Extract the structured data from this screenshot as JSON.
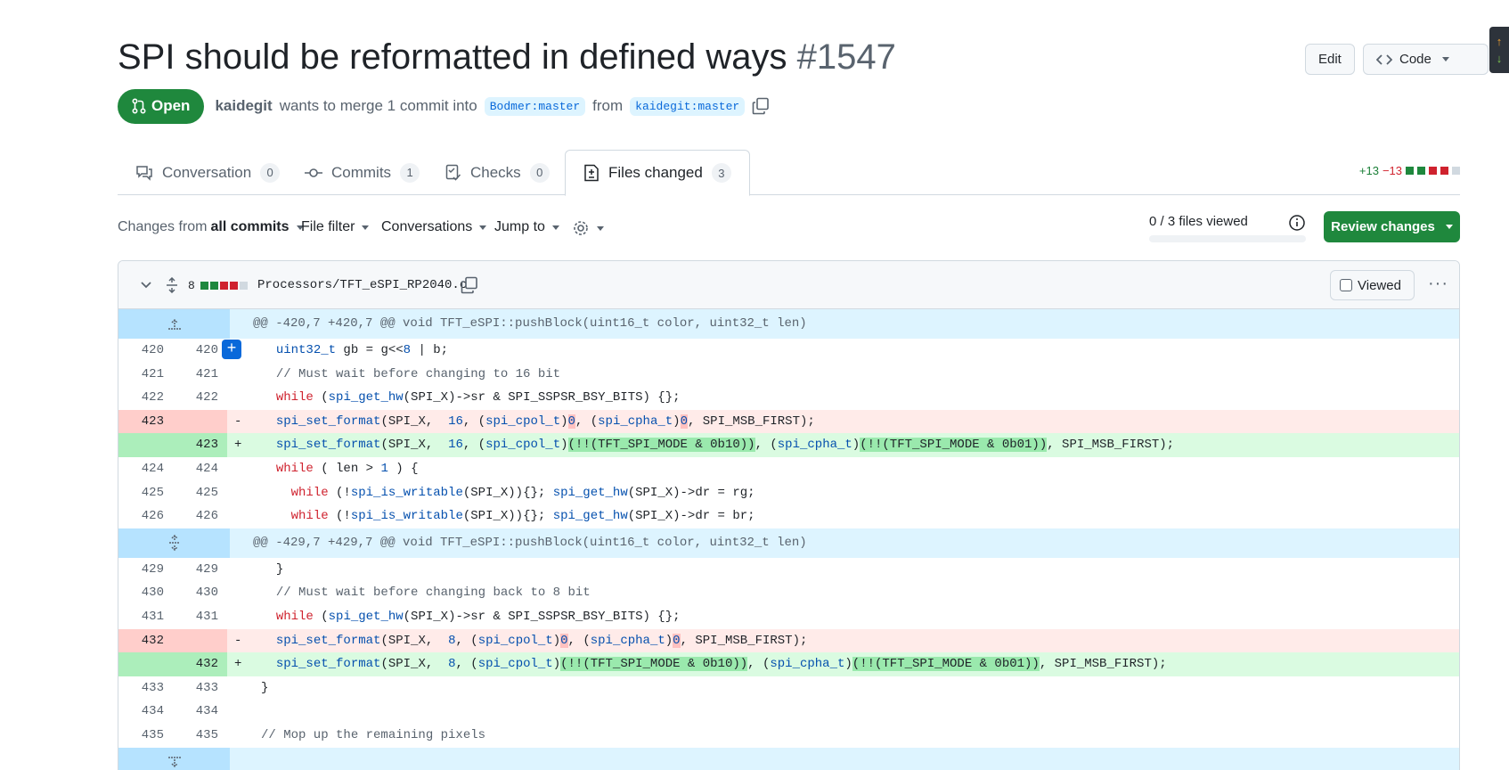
{
  "header": {
    "title": "SPI should be reformatted in defined ways",
    "number": "#1547",
    "edit_label": "Edit",
    "code_label": "Code"
  },
  "subtitle": {
    "state": "Open",
    "author": "kaidegit",
    "action": "wants to merge 1 commit into",
    "base_branch": "Bodmer:master",
    "from": "from",
    "head_branch": "kaidegit:master"
  },
  "tabs": [
    {
      "label": "Conversation",
      "count": "0"
    },
    {
      "label": "Commits",
      "count": "1"
    },
    {
      "label": "Checks",
      "count": "0"
    },
    {
      "label": "Files changed",
      "count": "3"
    }
  ],
  "diffstat": {
    "additions": "+13",
    "deletions": "−13"
  },
  "toolbar": {
    "changes_prefix": "Changes from",
    "changes_value": "all commits",
    "file_filter": "File filter",
    "conversations": "Conversations",
    "jump_to": "Jump to",
    "files_viewed": "0 / 3 files viewed",
    "review_label": "Review changes"
  },
  "file": {
    "changes": "8",
    "path": "Processors/TFT_eSPI_RP2040.c",
    "viewed_label": "Viewed",
    "more": "···"
  },
  "hunks": [
    "@@ -420,7 +420,7 @@ void TFT_eSPI::pushBlock(uint16_t color, uint32_t len)",
    "@@ -429,7 +429,7 @@ void TFT_eSPI::pushBlock(uint16_t color, uint32_t len)"
  ],
  "lines": {
    "l420": {
      "old": "420",
      "new": "420"
    },
    "l421": {
      "old": "421",
      "new": "421"
    },
    "l422": {
      "old": "422",
      "new": "422"
    },
    "l423d": {
      "old": "423",
      "new": ""
    },
    "l423a": {
      "old": "",
      "new": "423"
    },
    "l424": {
      "old": "424",
      "new": "424"
    },
    "l425": {
      "old": "425",
      "new": "425"
    },
    "l426": {
      "old": "426",
      "new": "426"
    },
    "l429": {
      "old": "429",
      "new": "429"
    },
    "l430": {
      "old": "430",
      "new": "430"
    },
    "l431": {
      "old": "431",
      "new": "431"
    },
    "l432d": {
      "old": "432",
      "new": ""
    },
    "l432a": {
      "old": "",
      "new": "432"
    },
    "l433": {
      "old": "433",
      "new": "433"
    },
    "l434": {
      "old": "434",
      "new": "434"
    },
    "l435": {
      "old": "435",
      "new": "435"
    }
  },
  "code": {
    "c420a": "uint32_t",
    "c420b": " gb = g<<",
    "c420c": "8",
    "c420d": " | b;",
    "c421": "// Must wait before changing to 16 bit",
    "c422kw": "while",
    "c422fn": "spi_get_hw",
    "c422rest": "(SPI_X)->sr & SPI_SSPSR_BSY_BITS) {};",
    "setfmt": "spi_set_format",
    "cpol": "spi_cpol_t",
    "cpha": "spi_cpha_t",
    "arg16": "(SPI_X,  ",
    "n16": "16",
    "arg8": "(SPI_X,  ",
    "n8": "8",
    "zero": "0",
    "mode_b10": "(!!(TFT_SPI_MODE & 0b10))",
    "mode_b01": "(!!(TFT_SPI_MODE & 0b01))",
    "msb": ", SPI_MSB_FIRST);",
    "c424kw": "while",
    "c424rest": " ( len > ",
    "c424n": "1",
    "c424end": " ) {",
    "c425fn1": "spi_is_writable",
    "c425rest1": "(SPI_X)){}; ",
    "c425fn2": "spi_get_hw",
    "c425rest2": "(SPI_X)->dr = rg;",
    "c426rest2": "(SPI_X)->dr = br;",
    "c429": "}",
    "c430": "// Must wait before changing back to 8 bit",
    "c433": "}",
    "c435": "// Mop up the remaining pixels"
  },
  "signs": {
    "minus": "-",
    "plus": "+"
  }
}
